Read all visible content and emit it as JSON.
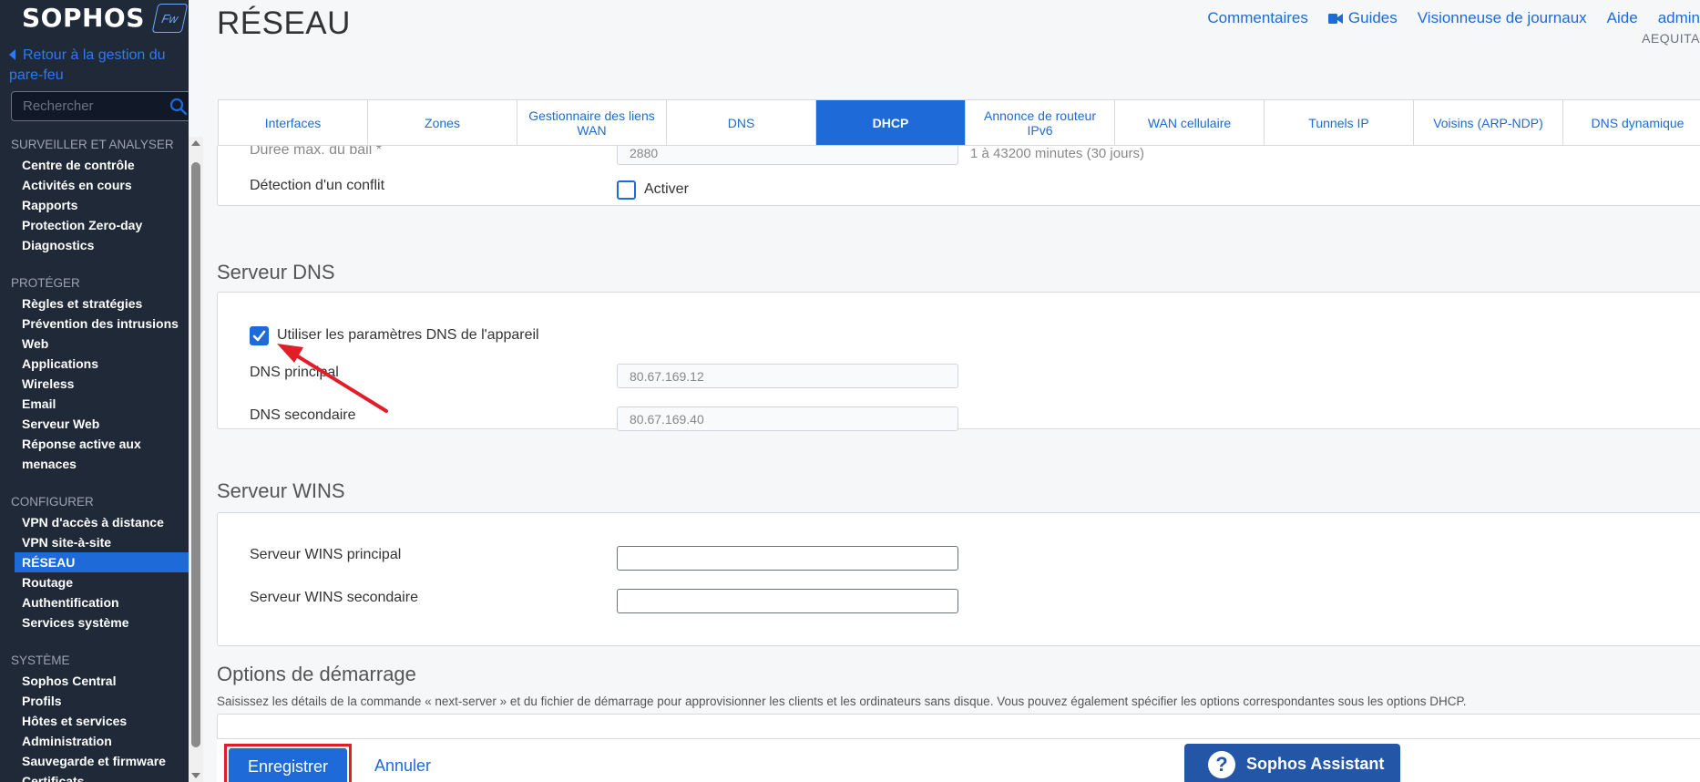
{
  "sidebar": {
    "logo": "SOPHOS",
    "logo_badge": "Fw",
    "back_link": "Retour à la gestion du pare-feu",
    "search_placeholder": "Rechercher",
    "sections": [
      {
        "title": "SURVEILLER ET ANALYSER",
        "items": [
          "Centre de contrôle",
          "Activités en cours",
          "Rapports",
          "Protection Zero-day",
          "Diagnostics"
        ]
      },
      {
        "title": "PROTÉGER",
        "items": [
          "Règles et stratégies",
          "Prévention des intrusions",
          "Web",
          "Applications",
          "Wireless",
          "Email",
          "Serveur Web",
          "Réponse active aux menaces"
        ]
      },
      {
        "title": "CONFIGURER",
        "items": [
          "VPN d'accès à distance",
          "VPN site-à-site",
          "RÉSEAU",
          "Routage",
          "Authentification",
          "Services système"
        ]
      },
      {
        "title": "SYSTÈME",
        "items": [
          "Sophos Central",
          "Profils",
          "Hôtes et services",
          "Administration",
          "Sauvegarde et firmware",
          "Certificats"
        ]
      }
    ]
  },
  "header": {
    "title": "RÉSEAU",
    "links": [
      "Commentaires",
      "Guides",
      "Visionneuse de journaux",
      "Aide",
      "admin"
    ],
    "org": "AEQUITA"
  },
  "tabs": [
    "Interfaces",
    "Zones",
    "Gestionnaire des liens WAN",
    "DNS",
    "DHCP",
    "Annonce de routeur IPv6",
    "WAN cellulaire",
    "Tunnels IP",
    "Voisins (ARP-NDP)",
    "DNS dynamique"
  ],
  "active_tab": "DHCP",
  "lease": {
    "label": "Durée max. du bail *",
    "value": "2880",
    "hint": "1 à 43200 minutes (30 jours)",
    "conflict_label": "Détection d'un conflit",
    "conflict_checkbox": "Activer"
  },
  "dns": {
    "title": "Serveur DNS",
    "use_device_label": "Utiliser les paramètres DNS de l'appareil",
    "primary_label": "DNS principal",
    "primary_value": "80.67.169.12",
    "secondary_label": "DNS secondaire",
    "secondary_value": "80.67.169.40"
  },
  "wins": {
    "title": "Serveur WINS",
    "primary_label": "Serveur WINS principal",
    "secondary_label": "Serveur WINS secondaire"
  },
  "boot": {
    "title": "Options de démarrage",
    "desc": "Saisissez les détails de la commande « next-server » et du fichier de démarrage pour approvisionner les clients et les ordinateurs sans disque. Vous pouvez également spécifier les options correspondantes sous les options DHCP."
  },
  "footer": {
    "save": "Enregistrer",
    "cancel": "Annuler",
    "assistant": "Sophos Assistant"
  },
  "colors": {
    "accent": "#1d6ad8",
    "sidebar_bg": "#1f2937",
    "annotation_red": "#e11d2a"
  }
}
